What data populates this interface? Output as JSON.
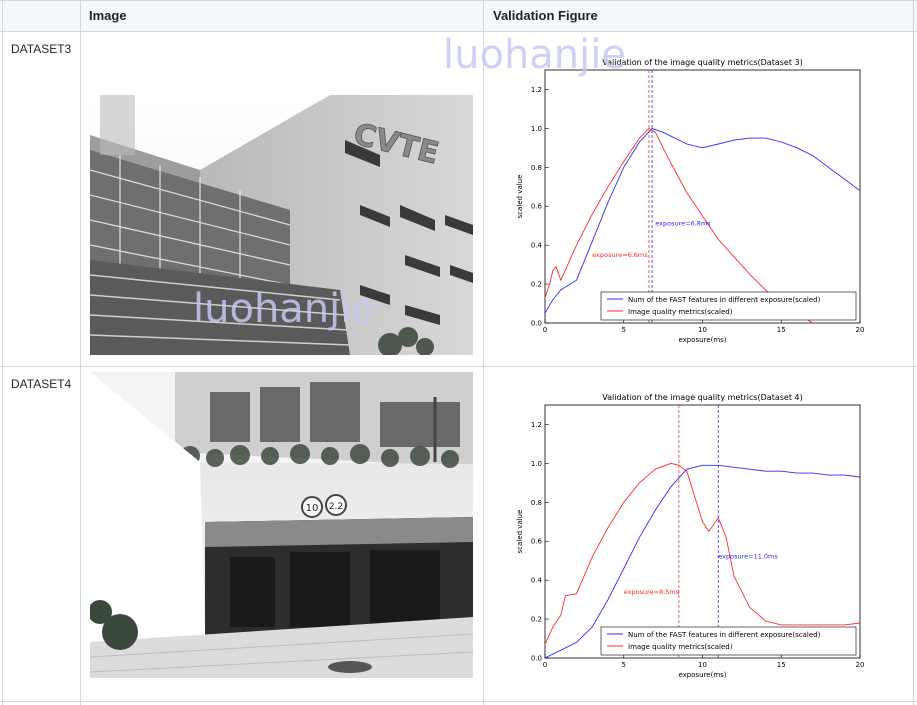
{
  "header": {
    "image_col": "Image",
    "figure_col": "Validation Figure"
  },
  "watermark": "luohanjie",
  "rows": [
    {
      "label": "DATASET3",
      "building_sign": "CVTE",
      "chart_data": {
        "type": "line",
        "title": "Validation of the image quality metrics(Dataset 3)",
        "xlabel": "exposure(ms)",
        "ylabel": "scaled value",
        "xlim": [
          0,
          20
        ],
        "ylim": [
          0,
          1.3
        ],
        "xticks": [
          "0",
          "5",
          "10",
          "15",
          "20"
        ],
        "yticks": [
          "0.0",
          "0.2",
          "0.4",
          "0.6",
          "0.8",
          "1.0",
          "1.2"
        ],
        "legend_position": "lower-right",
        "series": [
          {
            "name": "Num of the FAST features in different exposure(scaled)",
            "color": "#2b2bff",
            "x": [
              0,
              0.5,
              1,
              2,
              3,
              4,
              5,
              6,
              6.8,
              7.5,
              8,
              9,
              10,
              11,
              12,
              13,
              14,
              15,
              16,
              17,
              18,
              19,
              20
            ],
            "y": [
              0.05,
              0.12,
              0.17,
              0.22,
              0.42,
              0.62,
              0.8,
              0.93,
              1.0,
              0.98,
              0.96,
              0.92,
              0.9,
              0.92,
              0.94,
              0.95,
              0.95,
              0.93,
              0.9,
              0.86,
              0.8,
              0.74,
              0.68
            ]
          },
          {
            "name": "Image quality metrics(scaled)",
            "color": "#ff2b2b",
            "x": [
              0,
              0.3,
              0.5,
              0.7,
              1,
              2,
              3,
              4,
              5,
              6,
              6.6,
              7,
              8,
              9,
              10,
              11,
              12,
              13,
              14,
              15,
              16,
              17
            ],
            "y": [
              0.13,
              0.2,
              0.27,
              0.29,
              0.22,
              0.4,
              0.56,
              0.7,
              0.83,
              0.95,
              1.0,
              0.98,
              0.82,
              0.67,
              0.55,
              0.43,
              0.34,
              0.25,
              0.17,
              0.1,
              0.05,
              0.0
            ]
          }
        ],
        "vlines": [
          {
            "x": 6.6,
            "color": "#ff2b2b",
            "label": "exposure=6.6ms",
            "label_x": 3.0,
            "label_y": 0.34
          },
          {
            "x": 6.8,
            "color": "#2b2bff",
            "label": "exposure=6.8ms",
            "label_x": 7.0,
            "label_y": 0.5
          }
        ]
      }
    },
    {
      "label": "DATASET4",
      "sign_numbers": [
        "10",
        "2.2"
      ],
      "chart_data": {
        "type": "line",
        "title": "Validation of the image quality metrics(Dataset 4)",
        "xlabel": "exposure(ms)",
        "ylabel": "scaled value",
        "xlim": [
          0,
          20
        ],
        "ylim": [
          0,
          1.3
        ],
        "xticks": [
          "0",
          "5",
          "10",
          "15",
          "20"
        ],
        "yticks": [
          "0.0",
          "0.2",
          "0.4",
          "0.6",
          "0.8",
          "1.0",
          "1.2"
        ],
        "legend_position": "lower-right",
        "series": [
          {
            "name": "Num of the FAST features in different exposure(scaled)",
            "color": "#2b2bff",
            "x": [
              0,
              1,
              2,
              3,
              4,
              5,
              6,
              7,
              8,
              9,
              10,
              11,
              12,
              13,
              14,
              15,
              16,
              17,
              18,
              19,
              20
            ],
            "y": [
              0.0,
              0.04,
              0.08,
              0.16,
              0.3,
              0.46,
              0.62,
              0.76,
              0.88,
              0.97,
              0.99,
              0.99,
              0.98,
              0.97,
              0.96,
              0.96,
              0.95,
              0.95,
              0.94,
              0.94,
              0.93
            ]
          },
          {
            "name": "Image quality metrics(scaled)",
            "color": "#ff2b2b",
            "x": [
              0,
              0.5,
              1,
              1.3,
              2,
              3,
              4,
              5,
              6,
              7,
              8,
              8.5,
              9,
              10,
              10.4,
              11,
              11.5,
              12,
              13,
              14,
              15,
              16,
              17,
              18,
              19,
              20
            ],
            "y": [
              0.07,
              0.16,
              0.22,
              0.32,
              0.33,
              0.52,
              0.67,
              0.8,
              0.9,
              0.97,
              1.0,
              0.99,
              0.96,
              0.7,
              0.65,
              0.72,
              0.62,
              0.42,
              0.26,
              0.19,
              0.17,
              0.17,
              0.17,
              0.17,
              0.17,
              0.18
            ]
          }
        ],
        "vlines": [
          {
            "x": 8.5,
            "color": "#ff2b2b",
            "label": "exposure=8.5ms",
            "label_x": 5.0,
            "label_y": 0.33
          },
          {
            "x": 11.0,
            "color": "#2b2bff",
            "label": "exposure=11.0ms",
            "label_x": 11.0,
            "label_y": 0.51
          }
        ]
      }
    }
  ]
}
